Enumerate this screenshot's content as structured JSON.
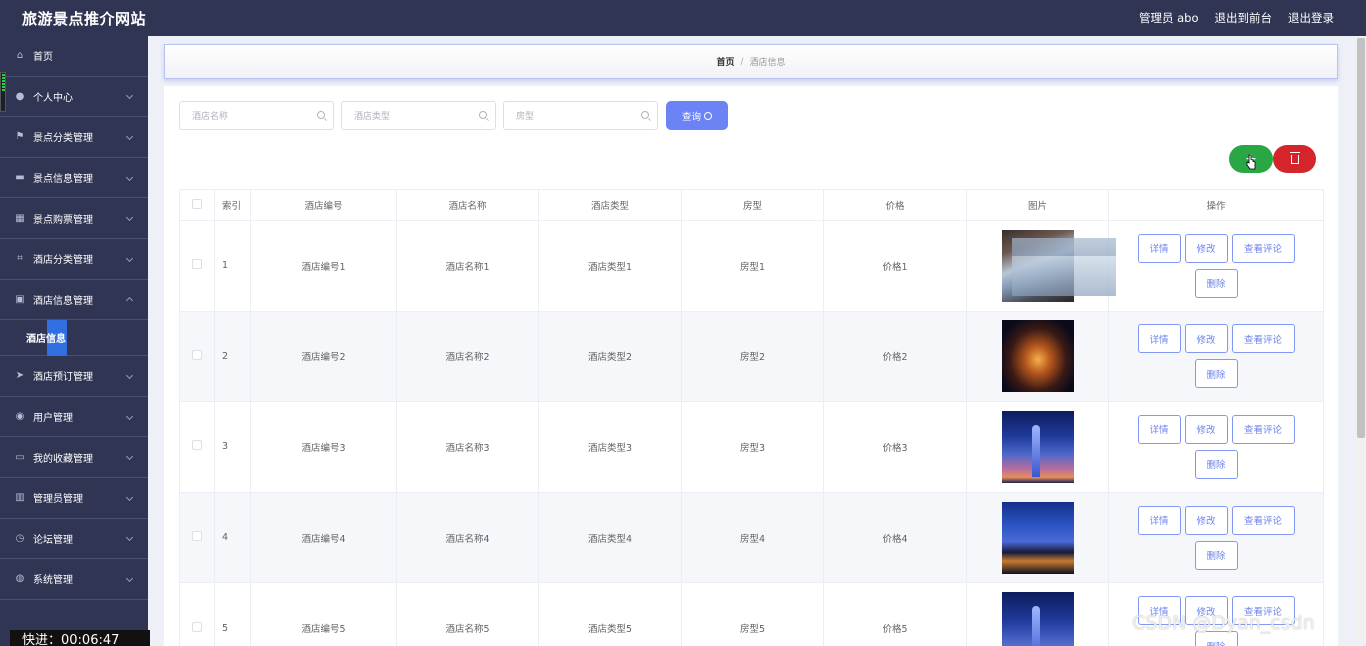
{
  "header": {
    "brand": "旅游景点推介网站",
    "user": "管理员 abo",
    "exit_front": "退出到前台",
    "logout": "退出登录"
  },
  "sidebar": {
    "items": [
      {
        "label": "首页",
        "icon": "home-icon"
      },
      {
        "label": "个人中心",
        "icon": "user-icon"
      },
      {
        "label": "景点分类管理",
        "icon": "flag-icon"
      },
      {
        "label": "景点信息管理",
        "icon": "sign-icon"
      },
      {
        "label": "景点购票管理",
        "icon": "grid-icon"
      },
      {
        "label": "酒店分类管理",
        "icon": "crop-icon"
      },
      {
        "label": "酒店信息管理",
        "icon": "clipboard-icon"
      },
      {
        "label": "酒店预订管理",
        "icon": "send-icon"
      },
      {
        "label": "用户管理",
        "icon": "location-icon"
      },
      {
        "label": "我的收藏管理",
        "icon": "chat-icon"
      },
      {
        "label": "管理员管理",
        "icon": "chart-icon"
      },
      {
        "label": "论坛管理",
        "icon": "clock-icon"
      },
      {
        "label": "系统管理",
        "icon": "globe-icon"
      }
    ],
    "active_sub": "酒店信息",
    "timer": "快进：00:06:47"
  },
  "breadcrumb": {
    "home": "首页",
    "separator": "/",
    "current": "酒店信息"
  },
  "search": {
    "name_placeholder": "酒店名称",
    "type_placeholder": "酒店类型",
    "room_placeholder": "房型",
    "query_label": "查询"
  },
  "actions": {
    "add_label": "+"
  },
  "table": {
    "headers": [
      "索引",
      "酒店编号",
      "酒店名称",
      "酒店类型",
      "房型",
      "价格",
      "图片",
      "操作"
    ],
    "rows": [
      {
        "idx": "1",
        "code": "酒店编号1",
        "name": "酒店名称1",
        "type": "酒店类型1",
        "room": "房型1",
        "price": "价格1"
      },
      {
        "idx": "2",
        "code": "酒店编号2",
        "name": "酒店名称2",
        "type": "酒店类型2",
        "room": "房型2",
        "price": "价格2"
      },
      {
        "idx": "3",
        "code": "酒店编号3",
        "name": "酒店名称3",
        "type": "酒店类型3",
        "room": "房型3",
        "price": "价格3"
      },
      {
        "idx": "4",
        "code": "酒店编号4",
        "name": "酒店名称4",
        "type": "酒店类型4",
        "room": "房型4",
        "price": "价格4"
      },
      {
        "idx": "5",
        "code": "酒店编号5",
        "name": "酒店名称5",
        "type": "酒店类型5",
        "room": "房型5",
        "price": "价格5"
      }
    ],
    "op_detail": "详情",
    "op_edit": "修改",
    "op_review": "查看评论",
    "op_delete": "删除"
  },
  "watermark": "CSDN @Dyan_csdn"
}
